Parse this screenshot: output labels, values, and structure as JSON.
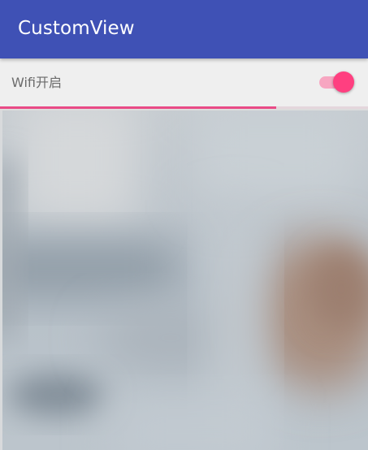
{
  "toolbar": {
    "title": "CustomView",
    "color": "#3f51b5"
  },
  "wifi": {
    "label": "Wifi开启",
    "toggle_on": true,
    "accent": "#ff3f80"
  },
  "progress": {
    "fraction": 0.75,
    "color": "#e94a86"
  },
  "background_image": {
    "icon": "blurred-photo-image"
  }
}
